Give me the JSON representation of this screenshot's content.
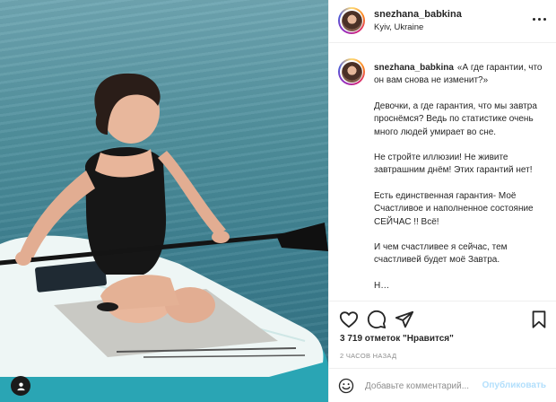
{
  "post": {
    "username": "snezhana_babkina",
    "location": "Kyiv, Ukraine",
    "caption": {
      "title": "«А где гарантии, что он вам снова не изменит?»",
      "paragraphs": [
        "Девочки, а где гарантия, что мы завтра проснёмся? Ведь по статистике очень много людей умирает во сне.",
        "Не стройте иллюзии! Не живите завтрашним днём! Этих гарантий нет!",
        "Есть единственная гарантия- Моё Счастливое и наполненное состояние СЕЙЧАС !! Всё!",
        "И чем счастливее я сейчас, тем счастливей будет моё Завтра.",
        "Н…"
      ]
    },
    "likes_text": "3 719 отметок \"Нравится\"",
    "time_text": "2 ЧАСОВ НАЗАД"
  },
  "comment": {
    "placeholder": "Добавьте комментарий...",
    "post_label": "Опубликовать"
  },
  "icons": {
    "more": "more-horizontal-icon",
    "like": "heart-icon",
    "comment": "comment-bubble-icon",
    "share": "paper-plane-icon",
    "save": "bookmark-icon",
    "emoji": "emoji-smile-icon",
    "corner": "user-tag-icon"
  },
  "colors": {
    "link": "#0095f6",
    "post_button_disabled": "#b2dffc",
    "text": "#262626",
    "muted": "#8e8e8e",
    "water": "#4f8f9c",
    "board": "#e9f3f2",
    "board_accent": "#2aa5b4"
  }
}
